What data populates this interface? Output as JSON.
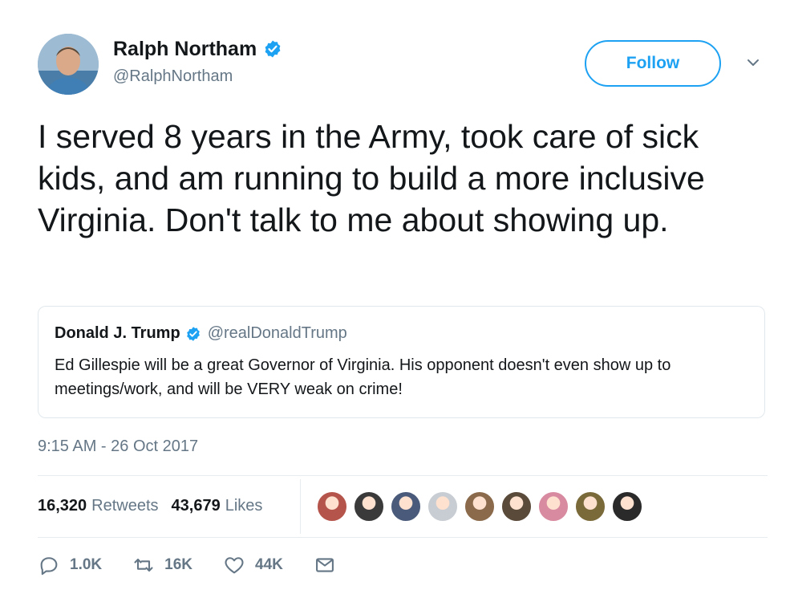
{
  "author": {
    "display_name": "Ralph Northam",
    "handle": "@RalphNortham",
    "verified": true
  },
  "follow_button": {
    "label": "Follow"
  },
  "tweet": {
    "text": "I served 8 years in the Army, took care of sick kids, and am running to build a more inclusive Virginia. Don't talk to me about showing up.",
    "timestamp": "9:15 AM - 26 Oct 2017"
  },
  "quoted_tweet": {
    "display_name": "Donald J. Trump",
    "handle": "@realDonaldTrump",
    "verified": true,
    "text": "Ed Gillespie will be a great Governor of Virginia. His opponent doesn't even show up to meetings/work, and will be VERY weak on crime!"
  },
  "stats": {
    "retweets_count": "16,320",
    "retweets_label": "Retweets",
    "likes_count": "43,679",
    "likes_label": "Likes"
  },
  "likers": [
    {
      "color": "#b5544a"
    },
    {
      "color": "#3a3a3a"
    },
    {
      "color": "#4a5a7a"
    },
    {
      "color": "#c8cdd3"
    },
    {
      "color": "#8a6a4a"
    },
    {
      "color": "#5a4a3a"
    },
    {
      "color": "#d88aa0"
    },
    {
      "color": "#7a6a3a"
    },
    {
      "color": "#2a2a2a"
    }
  ],
  "actions": {
    "replies": "1.0K",
    "retweets": "16K",
    "likes": "44K"
  },
  "colors": {
    "accent": "#1da1f2",
    "text": "#14171a",
    "secondary": "#657786",
    "border": "#e1e8ed"
  }
}
